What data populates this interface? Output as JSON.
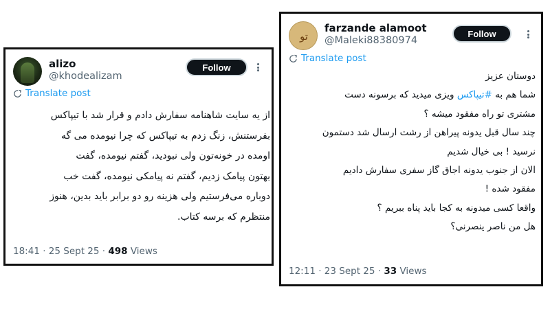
{
  "tweets": [
    {
      "display_name": "alizo",
      "handle": "@khodealizam",
      "follow_label": "Follow",
      "translate_label": "Translate post",
      "body_lines": [
        "از یه سایت شاهنامه سفارش دادم و قرار شد با تیپاکس",
        "بفرستنش، زنگ زدم به تیپاکس که چرا نیومده می گه",
        "اومده در خونه‌تون ولی نبودید، گفتم نیومده، گفت",
        "بهتون پیامک زدیم، گفتم نه پیامکی نیومده، گفت خب",
        "دوباره می‌فرستیم ولی هزینه رو دو برابر باید بدین، هنوز",
        "منتظرم که برسه کتاب."
      ],
      "time": "18:41",
      "date": "25 Sept 25",
      "views_count": "498",
      "views_label": "Views",
      "separator": "·"
    },
    {
      "display_name": "farzande alamoot",
      "handle": "@Maleki88380974",
      "follow_label": "Follow",
      "translate_label": "Translate post",
      "body_line_0": "دوستان عزیز",
      "body_line_1_prefix": "شما هم به ",
      "body_line_1_hashtag": "#تیپاکس",
      "body_line_1_suffix": " ویزی میدید که برسونه دست",
      "body_lines_rest": [
        "مشتری تو راه مفقود میشه ؟",
        "چند سال قبل یدونه پیراهن از رشت ارسال شد دستمون",
        "نرسید ! بی خیال شدیم",
        "الان از جنوب یدونه اجاق گاز سفری سفارش دادیم",
        "مفقود شده !",
        "واقعا کسی میدونه به کجا باید پناه ببریم ؟",
        "هل من ناصر ینصرنی؟"
      ],
      "time": "12:11",
      "date": "23 Sept 25",
      "views_count": "33",
      "views_label": "Views",
      "separator": "·"
    }
  ],
  "icons": {
    "translate": "translate-icon",
    "more": "more-options-icon",
    "avatar": "avatar"
  },
  "colors": {
    "link_blue": "#1d9bf0",
    "follow_bg": "#0f1419",
    "muted_text": "#536471",
    "card_border": "#111111"
  }
}
